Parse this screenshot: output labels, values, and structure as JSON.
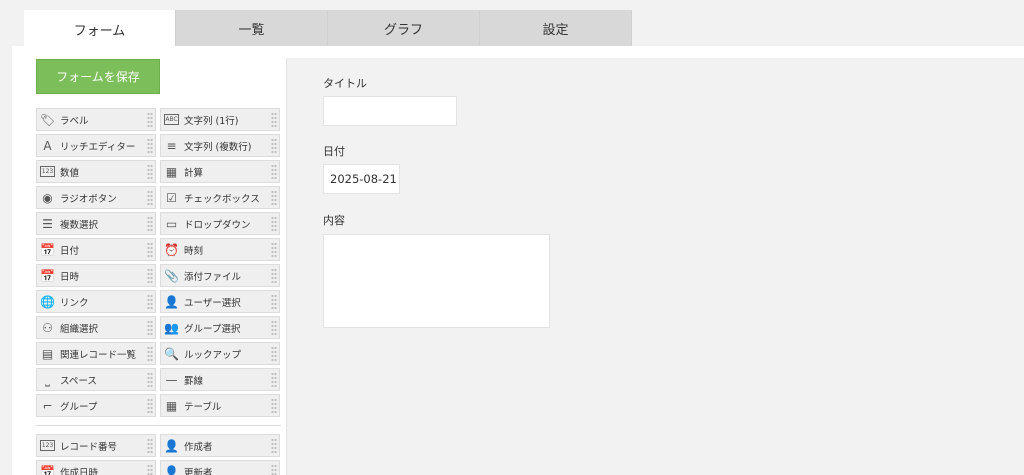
{
  "tabs": [
    "フォーム",
    "一覧",
    "グラフ",
    "設定"
  ],
  "save_label": "フォームを保存",
  "palette": [
    {
      "label": "ラベル",
      "icon": "tag-icon",
      "glyph": "🏷"
    },
    {
      "label": "文字列 (1行)",
      "icon": "text-single-line-icon",
      "glyph": "ABC"
    },
    {
      "label": "リッチエディター",
      "icon": "rich-editor-icon",
      "glyph": "A"
    },
    {
      "label": "文字列 (複数行)",
      "icon": "text-multi-line-icon",
      "glyph": "≡"
    },
    {
      "label": "数値",
      "icon": "number-icon",
      "glyph": "123"
    },
    {
      "label": "計算",
      "icon": "calculator-icon",
      "glyph": "▦"
    },
    {
      "label": "ラジオボタン",
      "icon": "radio-icon",
      "glyph": "◉"
    },
    {
      "label": "チェックボックス",
      "icon": "checkbox-icon",
      "glyph": "☑"
    },
    {
      "label": "複数選択",
      "icon": "multi-select-icon",
      "glyph": "☰"
    },
    {
      "label": "ドロップダウン",
      "icon": "dropdown-icon",
      "glyph": "▭"
    },
    {
      "label": "日付",
      "icon": "calendar-icon",
      "glyph": "📅"
    },
    {
      "label": "時刻",
      "icon": "clock-icon",
      "glyph": "⏰"
    },
    {
      "label": "日時",
      "icon": "datetime-icon",
      "glyph": "📅"
    },
    {
      "label": "添付ファイル",
      "icon": "paperclip-icon",
      "glyph": "📎"
    },
    {
      "label": "リンク",
      "icon": "globe-icon",
      "glyph": "🌐"
    },
    {
      "label": "ユーザー選択",
      "icon": "user-icon",
      "glyph": "👤"
    },
    {
      "label": "組織選択",
      "icon": "org-chart-icon",
      "glyph": "⚇"
    },
    {
      "label": "グループ選択",
      "icon": "group-icon",
      "glyph": "👥"
    },
    {
      "label": "関連レコード一覧",
      "icon": "related-records-icon",
      "glyph": "▤"
    },
    {
      "label": "ルックアップ",
      "icon": "lookup-icon",
      "glyph": "🔍"
    },
    {
      "label": "スペース",
      "icon": "space-icon",
      "glyph": "⎵"
    },
    {
      "label": "罫線",
      "icon": "line-icon",
      "glyph": "—"
    },
    {
      "label": "グループ",
      "icon": "group-field-icon",
      "glyph": "⌐"
    },
    {
      "label": "テーブル",
      "icon": "table-icon",
      "glyph": "▦"
    },
    {
      "label": "レコード番号",
      "icon": "record-number-icon",
      "glyph": "123"
    },
    {
      "label": "作成者",
      "icon": "creator-icon",
      "glyph": "👤"
    },
    {
      "label": "作成日時",
      "icon": "created-datetime-icon",
      "glyph": "📅"
    },
    {
      "label": "更新者",
      "icon": "updater-icon",
      "glyph": "👤"
    }
  ],
  "form": {
    "title_label": "タイトル",
    "title_value": "",
    "date_label": "日付",
    "date_value": "2025-08-21",
    "content_label": "内容",
    "content_value": ""
  }
}
